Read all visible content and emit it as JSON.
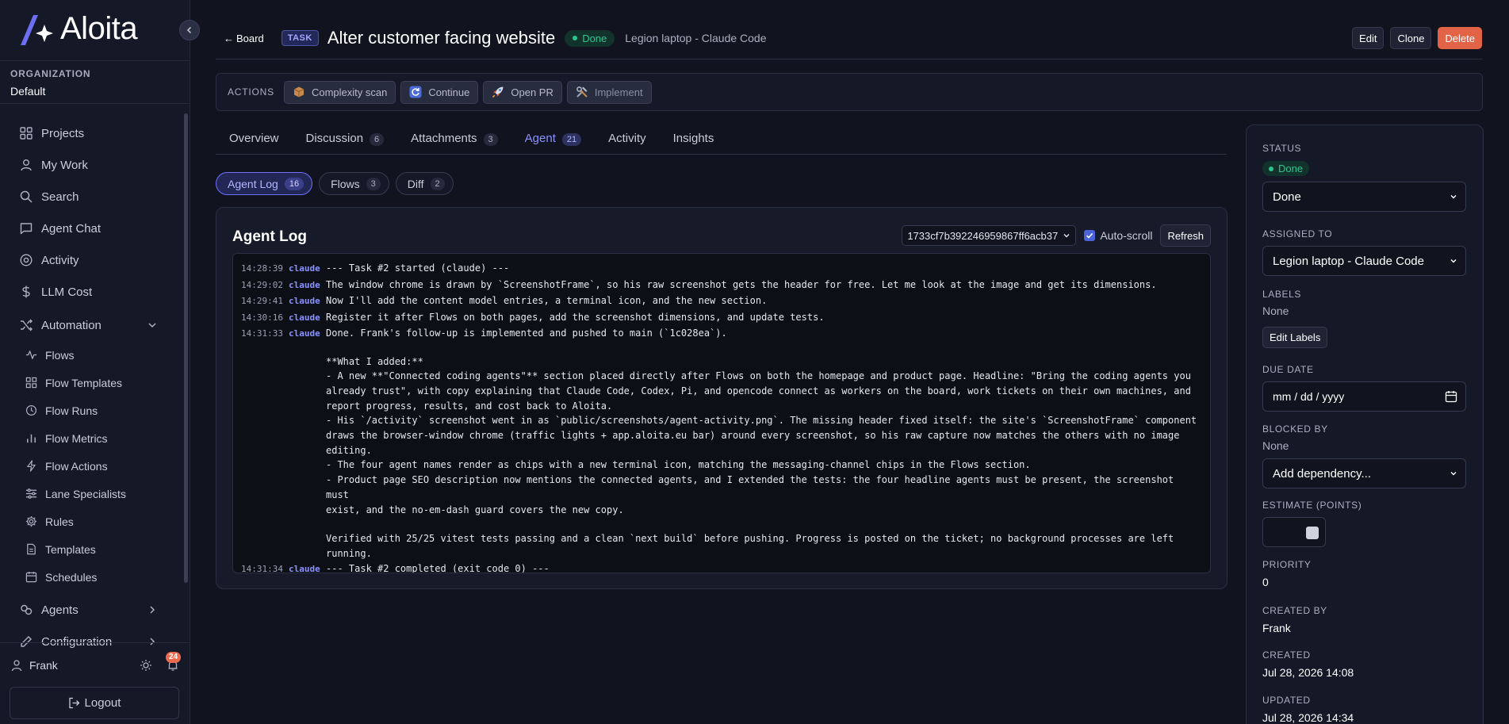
{
  "app": {
    "brand": "Aloita"
  },
  "organization": {
    "label": "ORGANIZATION",
    "value": "Default"
  },
  "sidebar": {
    "items": [
      {
        "label": "Projects",
        "icon": "grid-icon"
      },
      {
        "label": "My Work",
        "icon": "user-icon"
      },
      {
        "label": "Search",
        "icon": "search-icon"
      },
      {
        "label": "Agent Chat",
        "icon": "chat-icon"
      },
      {
        "label": "Activity",
        "icon": "target-icon"
      },
      {
        "label": "LLM Cost",
        "icon": "dollar-icon"
      }
    ],
    "automation": {
      "label": "Automation",
      "children": [
        {
          "label": "Flows",
          "icon": "pulse-icon"
        },
        {
          "label": "Flow Templates",
          "icon": "grid-icon"
        },
        {
          "label": "Flow Runs",
          "icon": "clock-icon"
        },
        {
          "label": "Flow Metrics",
          "icon": "bar-chart-icon"
        },
        {
          "label": "Flow Actions",
          "icon": "lightning-icon"
        },
        {
          "label": "Lane Specialists",
          "icon": "sliders-icon"
        },
        {
          "label": "Rules",
          "icon": "gear-icon"
        },
        {
          "label": "Templates",
          "icon": "document-icon"
        },
        {
          "label": "Schedules",
          "icon": "calendar-icon"
        }
      ]
    },
    "agents_label": "Agents",
    "configuration_label": "Configuration",
    "user": {
      "name": "Frank",
      "notifications": "24"
    },
    "logout_label": "Logout"
  },
  "header": {
    "back_label": "Board",
    "type_tag": "TASK",
    "title": "Alter customer facing website",
    "status": "Done",
    "assignee": "Legion laptop - Claude Code",
    "edit_label": "Edit",
    "clone_label": "Clone",
    "delete_label": "Delete"
  },
  "actions": {
    "label": "ACTIONS",
    "buttons": [
      {
        "label": "Complexity scan",
        "icon": "package-icon"
      },
      {
        "label": "Continue",
        "icon": "refresh-icon"
      },
      {
        "label": "Open PR",
        "icon": "rocket-icon"
      },
      {
        "label": "Implement",
        "icon": "tools-icon"
      }
    ]
  },
  "tabs": [
    {
      "label": "Overview",
      "count": ""
    },
    {
      "label": "Discussion",
      "count": "6"
    },
    {
      "label": "Attachments",
      "count": "3"
    },
    {
      "label": "Agent",
      "count": "21"
    },
    {
      "label": "Activity",
      "count": ""
    },
    {
      "label": "Insights",
      "count": ""
    }
  ],
  "subtabs": [
    {
      "label": "Agent Log",
      "count": "16"
    },
    {
      "label": "Flows",
      "count": "3"
    },
    {
      "label": "Diff",
      "count": "2"
    }
  ],
  "log": {
    "title": "Agent Log",
    "run_id": "1733cf7b392246959867ff6acb37",
    "autoscroll_label": "Auto-scroll",
    "refresh_label": "Refresh",
    "lines": [
      {
        "ts": "14:28:39",
        "src": "claude",
        "msg": "--- Task #2 started (claude) ---"
      },
      {
        "ts": "14:29:02",
        "src": "claude",
        "msg": "The window chrome is drawn by `ScreenshotFrame`, so his raw screenshot gets the header for free. Let me look at the image and get its dimensions."
      },
      {
        "ts": "14:29:41",
        "src": "claude",
        "msg": "Now I'll add the content model entries, a terminal icon, and the new section."
      },
      {
        "ts": "14:30:16",
        "src": "claude",
        "msg": "Register it after Flows on both pages, add the screenshot dimensions, and update tests."
      },
      {
        "ts": "14:31:33",
        "src": "claude",
        "msg": "Done. Frank's follow-up is implemented and pushed to main (`1c028ea`)."
      }
    ],
    "continuation": [
      "",
      "**What I added:**",
      "- A new **\"Connected coding agents\"** section placed directly after Flows on both the homepage and product page. Headline: \"Bring the coding agents you\nalready trust\", with copy explaining that Claude Code, Codex, Pi, and opencode connect as workers on the board, work tickets on their own machines, and\nreport progress, results, and cost back to Aloita.",
      "- His `/activity` screenshot went in as `public/screenshots/agent-activity.png`. The missing header fixed itself: the site's `ScreenshotFrame` component\ndraws the browser-window chrome (traffic lights + app.aloita.eu bar) around every screenshot, so his raw capture now matches the others with no image\nediting.",
      "- The four agent names render as chips with a new terminal icon, matching the messaging-channel chips in the Flows section.",
      "- Product page SEO description now mentions the connected agents, and I extended the tests: the four headline agents must be present, the screenshot must\nexist, and the no-em-dash guard covers the new copy.",
      "",
      "Verified with 25/25 vitest tests passing and a clean `next build` before pushing. Progress is posted on the ticket; no background processes are left\nrunning."
    ],
    "final": {
      "ts": "14:31:34",
      "src": "claude",
      "msg": "--- Task #2 completed (exit code 0) ---"
    }
  },
  "panel": {
    "status_label": "STATUS",
    "status_badge": "Done",
    "status_select": "Done",
    "assigned_label": "ASSIGNED TO",
    "assigned_select": "Legion laptop - Claude Code",
    "labels_label": "LABELS",
    "labels_value": "None",
    "edit_labels": "Edit Labels",
    "due_label": "DUE DATE",
    "due_placeholder": "mm / dd / yyyy",
    "blocked_label": "BLOCKED BY",
    "blocked_value": "None",
    "dependency_select": "Add dependency...",
    "estimate_label": "ESTIMATE (POINTS)",
    "priority_label": "PRIORITY",
    "priority_value": "0",
    "created_by_label": "CREATED BY",
    "created_by_value": "Frank",
    "created_label": "CREATED",
    "created_value": "Jul 28, 2026 14:08",
    "updated_label": "UPDATED",
    "updated_value": "Jul 28, 2026 14:34"
  },
  "colors": {
    "accent": "#8b92ff",
    "success": "#2dc48d",
    "danger": "#e36347",
    "background": "#11131e"
  }
}
